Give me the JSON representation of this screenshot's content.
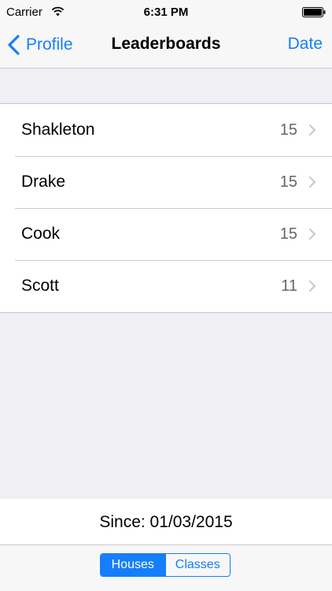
{
  "status_bar": {
    "carrier": "Carrier",
    "time": "6:31 PM"
  },
  "nav": {
    "back_label": "Profile",
    "title": "Leaderboards",
    "right_label": "Date"
  },
  "leaderboard": [
    {
      "name": "Shakleton",
      "score": "15"
    },
    {
      "name": "Drake",
      "score": "15"
    },
    {
      "name": "Cook",
      "score": "15"
    },
    {
      "name": "Scott",
      "score": "11"
    }
  ],
  "footer": {
    "since": "Since: 01/03/2015"
  },
  "segmented": {
    "options": [
      "Houses",
      "Classes"
    ],
    "selected": "Houses"
  },
  "colors": {
    "accent": "#157efb",
    "background": "#efeff4"
  },
  "icons": {
    "wifi": "wifi-icon",
    "battery": "battery-icon",
    "back": "chevron-left-icon",
    "disclosure": "chevron-right-icon"
  }
}
